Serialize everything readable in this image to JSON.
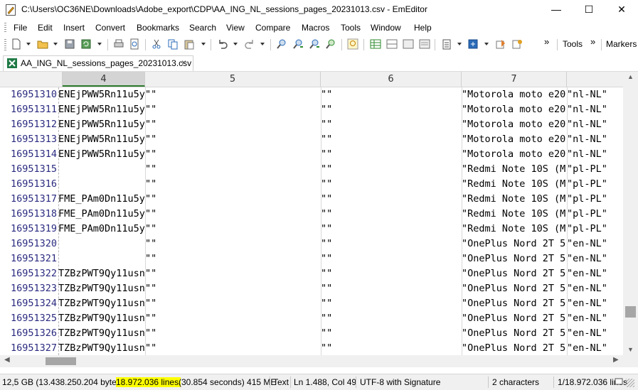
{
  "window": {
    "title": "C:\\Users\\OC36NE\\Downloads\\Adobe_export\\CDP\\AA_ING_NL_sessions_pages_20231013.csv - EmEditor",
    "minimize": "—",
    "maximize": "☐",
    "close": "✕"
  },
  "menu": [
    "File",
    "Edit",
    "Insert",
    "Convert",
    "Bookmarks",
    "Search",
    "View",
    "Compare",
    "Macros",
    "Tools",
    "Window",
    "Help"
  ],
  "toolbar": {
    "icons": [
      "new-file-icon",
      "open-folder-icon",
      "save-icon",
      "save-all-icon",
      "print-icon",
      "print-preview-icon",
      "cut-icon",
      "copy-icon",
      "paste-icon",
      "undo-icon",
      "redo-icon",
      "find-icon",
      "find-next-icon",
      "find-prev-icon",
      "find-in-files-icon",
      "highlight-icon",
      "csv-mode-icon",
      "split-icon",
      "columns-icon",
      "normal-mode-icon",
      "clipboard-icon",
      "plugins-icon",
      "macro-icon",
      "properties-icon"
    ],
    "overflow": "»",
    "tools_label": "Tools",
    "markers_label": "Markers"
  },
  "tab": {
    "label": "AA_ING_NL_sessions_pages_20231013.csv",
    "close": "×"
  },
  "columns": [
    "4",
    "5",
    "6",
    "7"
  ],
  "rows": [
    {
      "line": "16951310",
      "c4": "ENEjPWW5Rn11u5y",
      "c5": "\"\"",
      "c6": "\"\"",
      "c7": "\"Motorola moto e20\"",
      "c8": "\"nl-NL\""
    },
    {
      "line": "16951311",
      "c4": "ENEjPWW5Rn11u5y",
      "c5": "\"\"",
      "c6": "\"\"",
      "c7": "\"Motorola moto e20\"",
      "c8": "\"nl-NL\""
    },
    {
      "line": "16951312",
      "c4": "ENEjPWW5Rn11u5y",
      "c5": "\"\"",
      "c6": "\"\"",
      "c7": "\"Motorola moto e20\"",
      "c8": "\"nl-NL\""
    },
    {
      "line": "16951313",
      "c4": "ENEjPWW5Rn11u5y",
      "c5": "\"\"",
      "c6": "\"\"",
      "c7": "\"Motorola moto e20\"",
      "c8": "\"nl-NL\""
    },
    {
      "line": "16951314",
      "c4": "ENEjPWW5Rn11u5y",
      "c5": "\"\"",
      "c6": "\"\"",
      "c7": "\"Motorola moto e20\"",
      "c8": "\"nl-NL\""
    },
    {
      "line": "16951315",
      "c4": "",
      "c5": "\"\"",
      "c6": "\"\"",
      "c7": "\"Redmi Note 10S (M",
      "c8": "\"pl-PL\""
    },
    {
      "line": "16951316",
      "c4": "",
      "c5": "\"\"",
      "c6": "\"\"",
      "c7": "\"Redmi Note 10S (M",
      "c8": "\"pl-PL\""
    },
    {
      "line": "16951317",
      "c4": "FME_PAm0Dn11u5y",
      "c5": "\"\"",
      "c6": "\"\"",
      "c7": "\"Redmi Note 10S (M",
      "c8": "\"pl-PL\""
    },
    {
      "line": "16951318",
      "c4": "FME_PAm0Dn11u5y",
      "c5": "\"\"",
      "c6": "\"\"",
      "c7": "\"Redmi Note 10S (M",
      "c8": "\"pl-PL\""
    },
    {
      "line": "16951319",
      "c4": "FME_PAm0Dn11u5y",
      "c5": "\"\"",
      "c6": "\"\"",
      "c7": "\"Redmi Note 10S (M",
      "c8": "\"pl-PL\""
    },
    {
      "line": "16951320",
      "c4": "",
      "c5": "\"\"",
      "c6": "\"\"",
      "c7": "\"OnePlus Nord 2T 5",
      "c8": "\"en-NL\""
    },
    {
      "line": "16951321",
      "c4": "",
      "c5": "\"\"",
      "c6": "\"\"",
      "c7": "\"OnePlus Nord 2T 5",
      "c8": "\"en-NL\""
    },
    {
      "line": "16951322",
      "c4": "TZBzPWT9Qy11usn",
      "c5": "\"\"",
      "c6": "\"\"",
      "c7": "\"OnePlus Nord 2T 5",
      "c8": "\"en-NL\""
    },
    {
      "line": "16951323",
      "c4": "TZBzPWT9Qy11usn",
      "c5": "\"\"",
      "c6": "\"\"",
      "c7": "\"OnePlus Nord 2T 5",
      "c8": "\"en-NL\""
    },
    {
      "line": "16951324",
      "c4": "TZBzPWT9Qy11usn",
      "c5": "\"\"",
      "c6": "\"\"",
      "c7": "\"OnePlus Nord 2T 5",
      "c8": "\"en-NL\""
    },
    {
      "line": "16951325",
      "c4": "TZBzPWT9Qy11usn",
      "c5": "\"\"",
      "c6": "\"\"",
      "c7": "\"OnePlus Nord 2T 5",
      "c8": "\"en-NL\""
    },
    {
      "line": "16951326",
      "c4": "TZBzPWT9Qy11usn",
      "c5": "\"\"",
      "c6": "\"\"",
      "c7": "\"OnePlus Nord 2T 5",
      "c8": "\"en-NL\""
    },
    {
      "line": "16951327",
      "c4": "TZBzPWT9Qy11usn",
      "c5": "\"\"",
      "c6": "\"\"",
      "c7": "\"OnePlus Nord 2T 5",
      "c8": "\"en-NL\""
    }
  ],
  "status": {
    "file_size": "12,5 GB (13.438.250.204 bytes),",
    "lines": "18.972.036 lines.",
    "timing": "(30.854 seconds) 415 ME",
    "mode": "Text",
    "position": "Ln 1.488, Col 49",
    "encoding": "UTF-8 with Signature",
    "selection": "2 characters",
    "line_count": "1/18.972.036 lines",
    "highlight_color": "#ffff00"
  },
  "colors": {
    "line_number": "#2a2a80",
    "active_column_underline": "#2b7a2b"
  }
}
